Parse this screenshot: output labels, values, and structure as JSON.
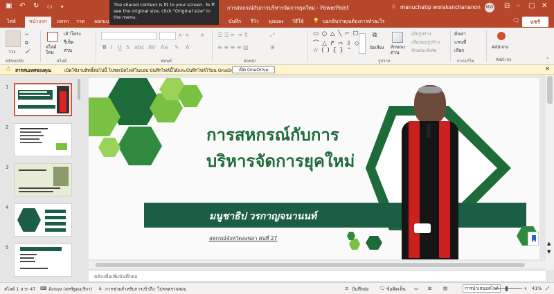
{
  "titlebar": {
    "doc_title": "การสหกรณ์กับการบริหารจัดการยุคใหม่  -  PowerPoint",
    "user_name": "manuchatip worakanchananon",
    "user_initials": "MW",
    "share_toast": "The shared content is fit to your screen. To see the original size, click \"Original size\" in the menu."
  },
  "tabs": [
    "ไฟล์",
    "หน้าแรก",
    "แทรก",
    "วาด",
    "ออกแบบ",
    "บันทึก",
    "รีวิว",
    "มุมมอง",
    "วิธีใช้",
    "บอกฉันว่าคุณต้องการทำอะไร"
  ],
  "share_label": "แชร์",
  "ribbon": {
    "groups": [
      "คลิปบอร์ด",
      "สไลด์",
      "ฟอนต์",
      "ย่อหน้า",
      "รูปวาด",
      "การแก้ไข",
      "Add-ins"
    ],
    "paste": "วาง",
    "new_slide": "สไลด์\nใหม่",
    "layout": "เค้าโครง",
    "reset": "รีเซ็ต",
    "section": "ส่วน",
    "arrange": "จัดเรียง",
    "quick_styles": "ลักษณะ\nด่วน",
    "fill": "เติมรูปร่าง",
    "outline": "เส้นขอบรูปร่าง",
    "effects": "ลักษณะพิเศษ",
    "find": "ค้นหา",
    "replace": "แทนที่",
    "select": "เลือก",
    "addins": "Add-ins"
  },
  "notification": {
    "title": "สารสนเทศของคุณ",
    "body": "เปิดใช้งานสิทธิ์ต่อไปนี้ โปรดเปิดไฟล์ในแอป บันทึกไฟล์นี้ได้และบันทึกไฟล์ไว้บน OneDrive",
    "button": "เปิด OneDrive"
  },
  "thumbnails": [
    "1",
    "2",
    "3",
    "4",
    "5"
  ],
  "slide": {
    "title_line1": "การสหกรณ์กับการ",
    "title_line2": "บริหารจัดการยุคใหม่",
    "presenter": "มนูชาธิป วรกาญจนานนท์",
    "org": "สหกรณ์จังหวัดสงขลา ศนที่ 27"
  },
  "notes_placeholder": "คลิกเพื่อเพิ่มบันทึกย่อ",
  "status": {
    "slide_count": "สไลด์ 1 จาก 47",
    "language": "อังกฤษ (สหรัฐอเมริกา)",
    "accessibility": "การช่วยสำหรับการเข้าถึง: ไปรลตรวจสอบ",
    "notes": "บันทึกย่อ",
    "comments": "ข้อคิดเห็น",
    "zoom": "41%",
    "fit_tooltip": "การนำเสนอสไลด์"
  },
  "colors": {
    "brand": "#b7472a",
    "slide_green_dark": "#1e6b3a",
    "slide_green_light": "#7ac043",
    "banner": "#1c5e45"
  }
}
